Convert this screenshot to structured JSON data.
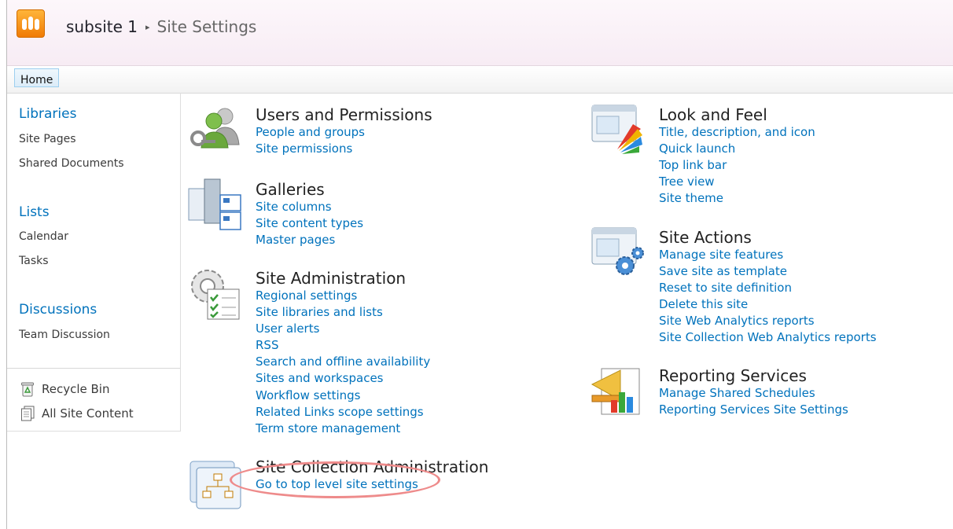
{
  "header": {
    "site_name": "subsite 1",
    "separator": "▸",
    "page_title": "Site Settings"
  },
  "topnav": {
    "home": "Home"
  },
  "quick_launch": {
    "libraries": {
      "heading": "Libraries",
      "items": [
        "Site Pages",
        "Shared Documents"
      ]
    },
    "lists": {
      "heading": "Lists",
      "items": [
        "Calendar",
        "Tasks"
      ]
    },
    "discussions": {
      "heading": "Discussions",
      "items": [
        "Team Discussion"
      ]
    },
    "recycle_bin": "Recycle Bin",
    "all_site_content": "All Site Content"
  },
  "groups": {
    "users": {
      "title": "Users and Permissions",
      "icon": "users-permissions-icon",
      "links": [
        "People and groups",
        "Site permissions"
      ]
    },
    "galleries": {
      "title": "Galleries",
      "icon": "galleries-icon",
      "links": [
        "Site columns",
        "Site content types",
        "Master pages"
      ]
    },
    "site_admin": {
      "title": "Site Administration",
      "icon": "site-administration-icon",
      "links": [
        "Regional settings",
        "Site libraries and lists",
        "User alerts",
        "RSS",
        "Search and offline availability",
        "Sites and workspaces",
        "Workflow settings",
        "Related Links scope settings",
        "Term store management"
      ]
    },
    "site_collection_admin": {
      "title": "Site Collection Administration",
      "icon": "site-collection-administration-icon",
      "links": [
        "Go to top level site settings"
      ]
    },
    "look_feel": {
      "title": "Look and Feel",
      "icon": "look-and-feel-icon",
      "links": [
        "Title, description, and icon",
        "Quick launch",
        "Top link bar",
        "Tree view",
        "Site theme"
      ]
    },
    "site_actions": {
      "title": "Site Actions",
      "icon": "site-actions-icon",
      "links": [
        "Manage site features",
        "Save site as template",
        "Reset to site definition",
        "Delete this site",
        "Site Web Analytics reports",
        "Site Collection Web Analytics reports"
      ]
    },
    "reporting": {
      "title": "Reporting Services",
      "icon": "reporting-services-icon",
      "links": [
        "Manage Shared Schedules",
        "Reporting Services Site Settings"
      ]
    }
  },
  "colors": {
    "link": "#0072bc",
    "annotation": "#ee8b8b",
    "brand": "#f39512"
  }
}
